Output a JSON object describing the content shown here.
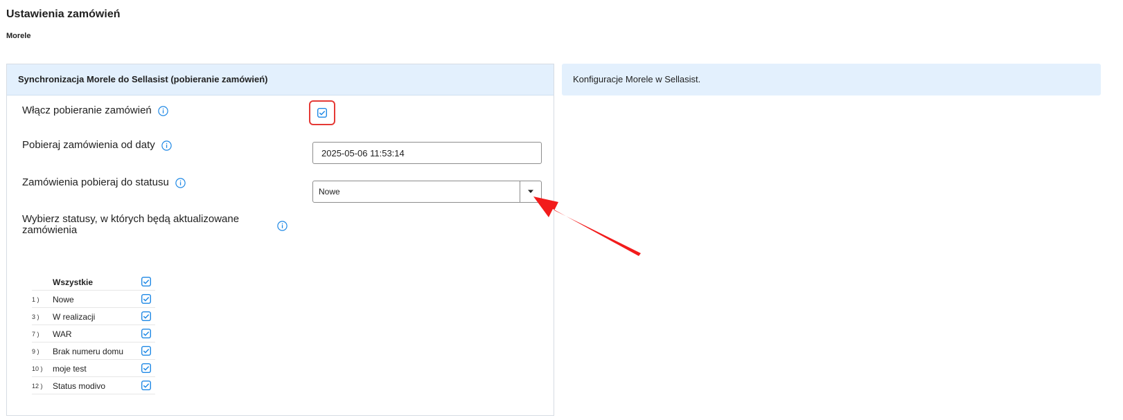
{
  "header": {
    "title": "Ustawienia zamówień",
    "subtitle": "Morele"
  },
  "panel": {
    "title": "Synchronizacja Morele do Sellasist (pobieranie zamówień)",
    "enable_label": "Włącz pobieranie zamówień",
    "enable_checked": true,
    "date_label": "Pobieraj zamówienia od daty",
    "date_value": "2025-05-06 11:53:14",
    "status_label": "Zamówienia pobieraj do statusu",
    "status_value": "Nowe",
    "update_statuses_label": "Wybierz statusy, w których będą aktualizowane zamówienia",
    "statuses_all_label": "Wszystkie",
    "statuses": [
      {
        "id": "1 )",
        "name": "Nowe",
        "checked": true
      },
      {
        "id": "3 )",
        "name": "W realizacji",
        "checked": true
      },
      {
        "id": "7 )",
        "name": "WAR",
        "checked": true
      },
      {
        "id": "9 )",
        "name": "Brak numeru domu",
        "checked": true
      },
      {
        "id": "10 )",
        "name": "moje test",
        "checked": true
      },
      {
        "id": "12 )",
        "name": "Status modivo",
        "checked": true
      }
    ]
  },
  "side": {
    "text": "Konfiguracje Morele w Sellasist."
  },
  "colors": {
    "accent": "#1e88e5",
    "highlight": "#e53935",
    "panel_header_bg": "#e3f0fd"
  },
  "icons": {
    "info": "info-icon",
    "checkbox": "checkbox-checked-icon",
    "dropdown": "caret-down-icon",
    "annotation": "red-arrow-annotation"
  }
}
